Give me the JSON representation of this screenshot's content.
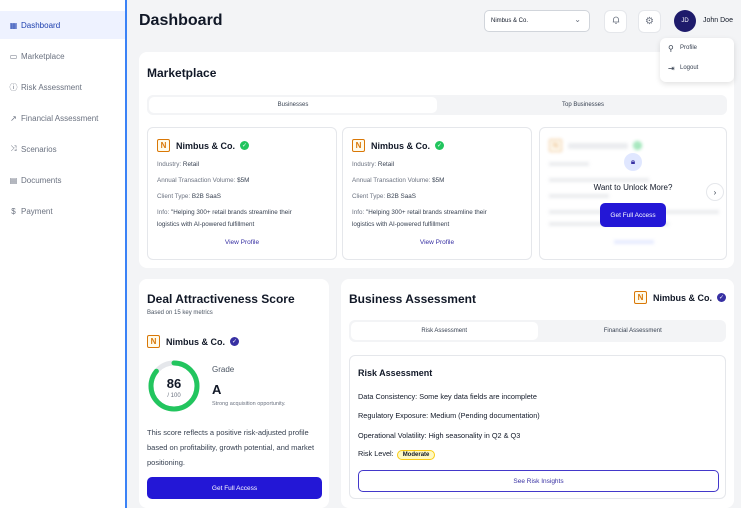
{
  "sidebar": {
    "items": [
      {
        "label": "Dashboard",
        "icon": "grid-icon",
        "active": true
      },
      {
        "label": "Marketplace",
        "icon": "folder-icon"
      },
      {
        "label": "Risk Assessment",
        "icon": "info-circle-icon"
      },
      {
        "label": "Financial Assessment",
        "icon": "trend-line-icon"
      },
      {
        "label": "Scenarios",
        "icon": "shuffle-icon"
      },
      {
        "label": "Documents",
        "icon": "document-icon"
      },
      {
        "label": "Payment",
        "icon": "dollar-icon"
      }
    ]
  },
  "header": {
    "title": "Dashboard",
    "company_select": "Nimbus & Co.",
    "avatar_initials": "JD",
    "user_name": "John Doe"
  },
  "user_menu": {
    "profile": "Profile",
    "logout": "Logout"
  },
  "marketplace": {
    "title": "Marketplace",
    "tabs": [
      "Businesses",
      "Top Businesses"
    ],
    "businesses": [
      {
        "name": "Nimbus & Co.",
        "industry_label": "Industry:",
        "industry": "Retail",
        "volume_label": "Annual Transaction Volume:",
        "volume": "$5M",
        "client_label": "Client Type:",
        "client": "B2B SaaS",
        "info_label": "Info:",
        "info_line1": "\"Helping 300+ retail brands streamline their",
        "info_line2": "logistics with AI-powered fulfillment",
        "link": "View Profile"
      },
      {
        "name": "Nimbus & Co.",
        "industry_label": "Industry:",
        "industry": "Retail",
        "volume_label": "Annual Transaction Volume:",
        "volume": "$5M",
        "client_label": "Client Type:",
        "client": "B2B SaaS",
        "info_label": "Info:",
        "info_line1": "\"Helping 300+ retail brands streamline their",
        "info_line2": "logistics with AI-powered fulfillment",
        "link": "View Profile"
      }
    ],
    "locked": {
      "text": "Want to Unlock More?",
      "button": "Get Full Access"
    }
  },
  "deal": {
    "title": "Deal Attractiveness Score",
    "subtitle": "Based on 15 key metrics",
    "company": "Nimbus & Co.",
    "score": "86",
    "score_max": "/ 100",
    "score_fraction": 0.86,
    "grade_label": "Grade",
    "grade": "A",
    "grade_note": "Strong acquisition opportunity.",
    "description": "This score reflects a positive risk-adjusted profile based on profitability, growth potential, and market positioning.",
    "button": "Get Full Access"
  },
  "business_assessment": {
    "title": "Business Assessment",
    "company": "Nimbus & Co.",
    "tabs": [
      "Risk Assessment",
      "Financial Assessment"
    ],
    "risk": {
      "title": "Risk Assessment",
      "consistency_label": "Data Consistency:",
      "consistency": "Some key data fields are incomplete",
      "regulatory_label": "Regulatory Exposure:",
      "regulatory": "Medium (Pending documentation)",
      "volatility_label": "Operational Volatility:",
      "volatility": "High seasonality in Q2 & Q3",
      "level_label": "Risk Level:",
      "level": "Moderate",
      "button": "See Risk Insights"
    }
  },
  "colors": {
    "accent": "#2317d6",
    "gauge": "#22c55e",
    "verified_blue": "#3730a3",
    "verified_green": "#22c55e"
  }
}
